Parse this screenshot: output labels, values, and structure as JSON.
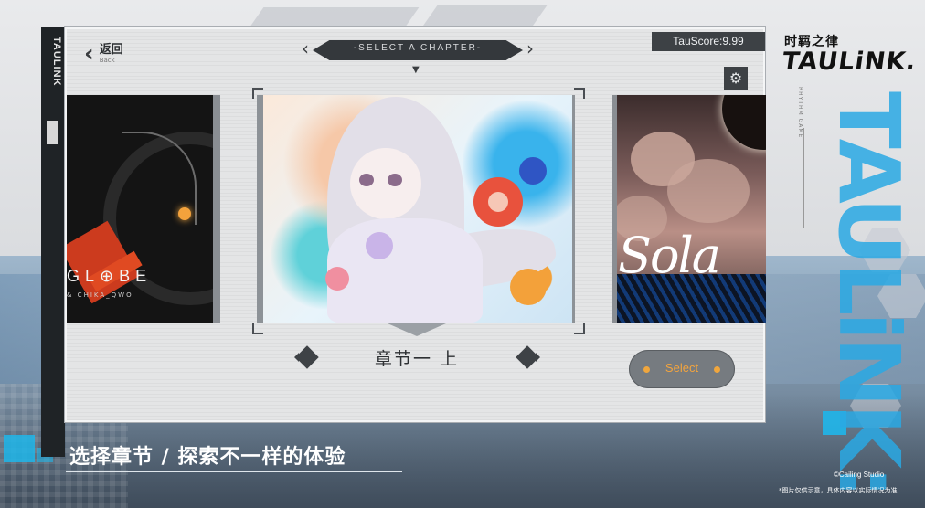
{
  "sidebar": {
    "label": "TAULINK"
  },
  "back": {
    "label": "返回",
    "sublabel": "Back",
    "icon": "chevron-left-icon"
  },
  "header": {
    "title": "-SELECT A CHAPTER-",
    "pointer": "▼"
  },
  "score": {
    "text": "TauScore:9.99"
  },
  "settings": {
    "icon": "gear-icon",
    "glyph": "⚙"
  },
  "cards": {
    "left": {
      "title": "GL⊕BE",
      "subtitle": "& CHIKA_QWO"
    },
    "center": {
      "art": "anime-girl-illustration"
    },
    "right": {
      "title": "Sola"
    }
  },
  "chapter": {
    "name": "章节一 上"
  },
  "select_button": {
    "label": "Select"
  },
  "branding": {
    "cn_name": "时羁之律",
    "en_name": "TAULiNK.",
    "small_text": "RHYTHM GAME",
    "big_vertical": "TAULiNK:"
  },
  "slogan": "选择章节 / 探索不一样的体验",
  "footer": {
    "copyright": "©Cailing Studio",
    "disclaimer": "*图片仅供示意，具体内容以实际情况为准"
  },
  "colors": {
    "accent": "#2aa9e4",
    "select_text": "#f2a43e",
    "panel": "#e4e5e6",
    "dark": "#34383c"
  }
}
